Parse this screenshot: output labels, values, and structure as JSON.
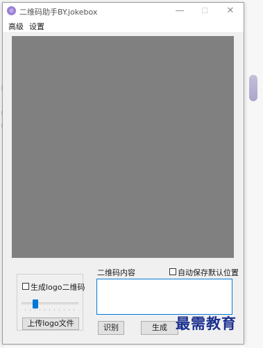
{
  "window": {
    "title": "二维码助手BY.jokebox",
    "minimize_glyph": "—",
    "maximize_glyph": "☐",
    "close_glyph": "✕"
  },
  "menu": {
    "items": [
      "高级",
      "设置"
    ]
  },
  "logo_group": {
    "checkbox_label": "生成logo二维码",
    "checkbox_checked": false,
    "slider_value_fraction": 0.2,
    "upload_button_label": "上传logo文件"
  },
  "content": {
    "label": "二维码内容",
    "input_value": "",
    "auto_save_label": "自动保存默认位置",
    "auto_save_checked": false
  },
  "actions": {
    "recognize_label": "识别",
    "generate_label": "生成"
  },
  "watermark": {
    "text": "最需教育"
  },
  "colors": {
    "preview": "#808080",
    "accent": "#0078d7"
  }
}
